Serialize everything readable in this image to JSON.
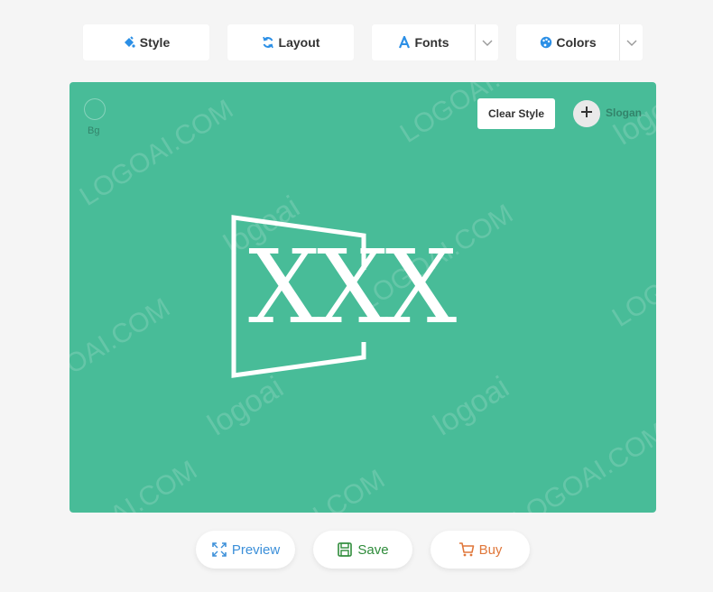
{
  "toolbar": {
    "style_label": "Style",
    "layout_label": "Layout",
    "fonts_label": "Fonts",
    "colors_label": "Colors"
  },
  "canvas": {
    "background_color": "#48bc98",
    "bg_label": "Bg",
    "clear_style_label": "Clear Style",
    "slogan_label": "Slogan",
    "logo_text": "XXX",
    "watermark_domain": "LOGOAI.COM",
    "watermark_brand": "logoai"
  },
  "actions": {
    "preview_label": "Preview",
    "save_label": "Save",
    "buy_label": "Buy",
    "preview_color": "#3b8fd9",
    "save_color": "#2e8b3a",
    "buy_color": "#e0773a"
  },
  "icons": {
    "style": "paint-bucket-icon",
    "layout": "refresh-icon",
    "fonts": "font-a-icon",
    "colors": "palette-icon",
    "dropdown": "chevron-down-icon",
    "slogan_add": "plus-icon",
    "preview": "expand-icon",
    "save": "save-icon",
    "buy": "cart-icon"
  }
}
